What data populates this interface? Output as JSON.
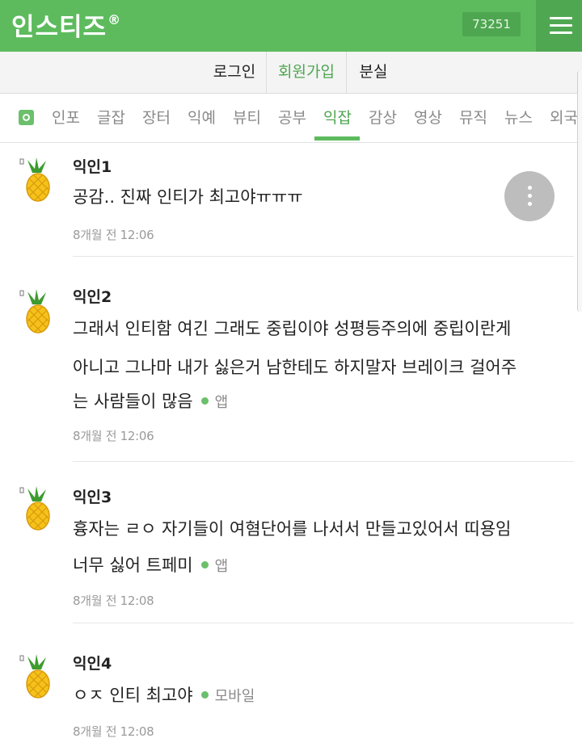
{
  "header": {
    "logo": "인스티즈",
    "logo_mark": "®",
    "counter": "73251",
    "menu_icon": "hamburger-menu-icon"
  },
  "auth": {
    "login": "로그인",
    "signup": "회원가입",
    "lost": "분실"
  },
  "categories": [
    "인포",
    "글잡",
    "장터",
    "익예",
    "뷰티",
    "공부",
    "익잡",
    "감상",
    "영상",
    "뮤직",
    "뉴스",
    "외국"
  ],
  "active_category": "익잡",
  "colors": {
    "brand": "#5dbb5e",
    "brand_dark": "#4fa851",
    "active_tab": "#5dbb5e",
    "status_dot": "#6bc06b"
  },
  "comments": [
    {
      "author": "익인1",
      "lines": [
        "공감.. 진짜 인티가 최고야ㅠㅠㅠ"
      ],
      "device": "",
      "time": "8개월 전 12:06"
    },
    {
      "author": "익인2",
      "lines": [
        "그래서 인티함 여긴 그래도 중립이야 성평등주의에 중립이란게",
        "아니고 그나마 내가 싫은거 남한테도 하지말자 브레이크 걸어주",
        "는 사람들이 많음"
      ],
      "device": "앱",
      "time": "8개월 전 12:06"
    },
    {
      "author": "익인3",
      "lines": [
        "흉자는 ㄹㅇ 자기들이 여혐단어를 나서서 만들고있어서 띠용임",
        "너무 싫어 트페미"
      ],
      "device": "앱",
      "time": "8개월 전 12:08"
    },
    {
      "author": "익인4",
      "lines": [
        "ㅇㅈ 인티 최고야"
      ],
      "device": "모바일",
      "time": "8개월 전 12:08"
    }
  ]
}
